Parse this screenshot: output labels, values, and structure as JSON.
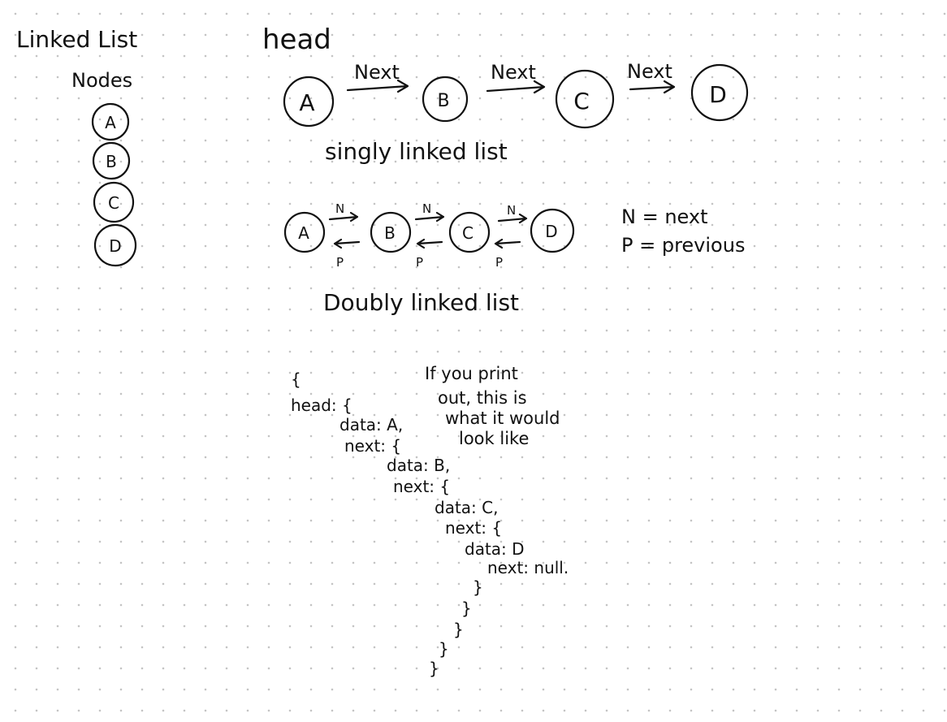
{
  "left_panel": {
    "title": "Linked List",
    "subtitle": "Nodes",
    "nodes": [
      "A",
      "B",
      "C",
      "D"
    ]
  },
  "singly": {
    "head_label": "head",
    "nodes": [
      "A",
      "B",
      "C",
      "D"
    ],
    "arrow_label": "Next",
    "caption": "singly linked list"
  },
  "doubly": {
    "nodes": [
      "A",
      "B",
      "C",
      "D"
    ],
    "next_label": "N",
    "prev_label": "P",
    "caption": "Doubly linked list",
    "legend": [
      "N = next",
      "P = previous"
    ]
  },
  "printout": {
    "note": [
      "If you print",
      "out, this is",
      "what it would",
      "look like"
    ],
    "code_lines": [
      "{",
      "head: {",
      "data: A,",
      "next: {",
      "data: B,",
      "next: {",
      "data: C,",
      "next: {",
      "data: D",
      "next: null.",
      "}",
      "}",
      "}",
      "}",
      "}"
    ]
  }
}
